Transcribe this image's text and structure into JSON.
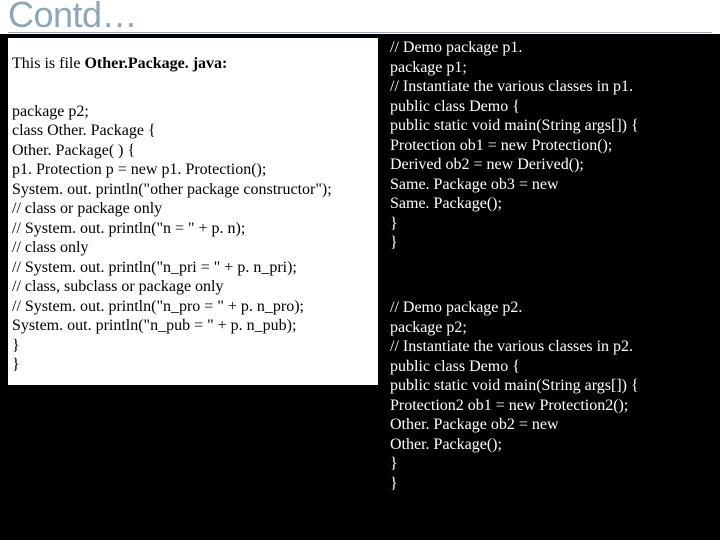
{
  "title": "Contd…",
  "left": {
    "intro_prefix": "This is file ",
    "intro_bold": "Other.Package. java:",
    "lines": [
      "package p2;",
      "class Other. Package {",
      "Other. Package( ) {",
      "p1. Protection p = new p1. Protection();",
      "System. out. println(\"other package constructor\");",
      "// class or package only",
      "// System. out. println(\"n = \" + p. n);",
      "// class only",
      "// System. out. println(\"n_pri = \" + p. n_pri);",
      "// class, subclass or package only",
      "// System. out. println(\"n_pro = \" + p. n_pro);",
      "System. out. println(\"n_pub = \" + p. n_pub);",
      "}",
      "}"
    ]
  },
  "right_top": {
    "lines": [
      "// Demo package p1.",
      "package p1;",
      "// Instantiate the various classes in p1.",
      "public class Demo {",
      "public static void main(String args[]) {",
      "Protection ob1 = new Protection();",
      "Derived ob2 = new Derived();",
      "Same. Package ob3 = new",
      "Same. Package();",
      "}",
      "}"
    ]
  },
  "right_bot": {
    "lines": [
      "// Demo package p2.",
      "package p2;",
      "// Instantiate the various classes in p2.",
      "public class Demo {",
      "public static void main(String args[]) {",
      "Protection2 ob1 = new Protection2();",
      "Other. Package ob2 = new",
      "Other. Package();",
      "}",
      "}"
    ]
  }
}
